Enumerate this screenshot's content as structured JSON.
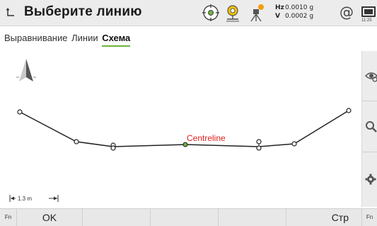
{
  "titlebar": {
    "title": "Выберите линию",
    "hz_label": "Hz",
    "hz_value": "0.0010 g",
    "v_label": "V",
    "v_value": "0.0002 g",
    "at_symbol": "@",
    "time": "11:25"
  },
  "tabs": [
    {
      "label": "Выравнивание",
      "active": false
    },
    {
      "label": "Линии",
      "active": false
    },
    {
      "label": "Схема",
      "active": true
    }
  ],
  "plot": {
    "line_label": "Centreline",
    "scale_label": "1.3 m"
  },
  "softkeys": {
    "fn_left": "Fn",
    "ok": "OK",
    "page": "Стр",
    "fn_right": "Fn"
  },
  "colors": {
    "accent": "#6db33f",
    "line_label": "#e02020",
    "selected_point": "#6db33f"
  }
}
